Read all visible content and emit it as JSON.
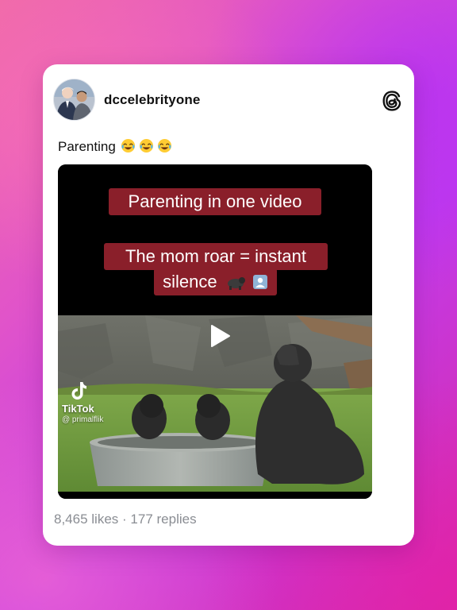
{
  "post": {
    "username": "dccelebrityone",
    "caption": "Parenting",
    "caption_emojis": [
      "tears-of-joy",
      "tears-of-joy",
      "tears-of-joy"
    ],
    "platform_logo": "threads-logo-icon"
  },
  "video": {
    "overlay_line1": "Parenting in one video",
    "overlay_line2a": "The mom roar = instant",
    "overlay_line2b": "silence",
    "overlay_line2_icons": [
      "gorilla",
      "person-in-frame"
    ],
    "watermark_brand": "TikTok",
    "watermark_handle": "@ primalflik",
    "play_icon": "play-icon"
  },
  "stats": {
    "likes": "8,465 likes",
    "separator": "·",
    "replies": "177 replies"
  },
  "colors": {
    "overlay_pill": "#8a1f2a",
    "stats_text": "#8a8d93",
    "card_bg": "#ffffff"
  }
}
